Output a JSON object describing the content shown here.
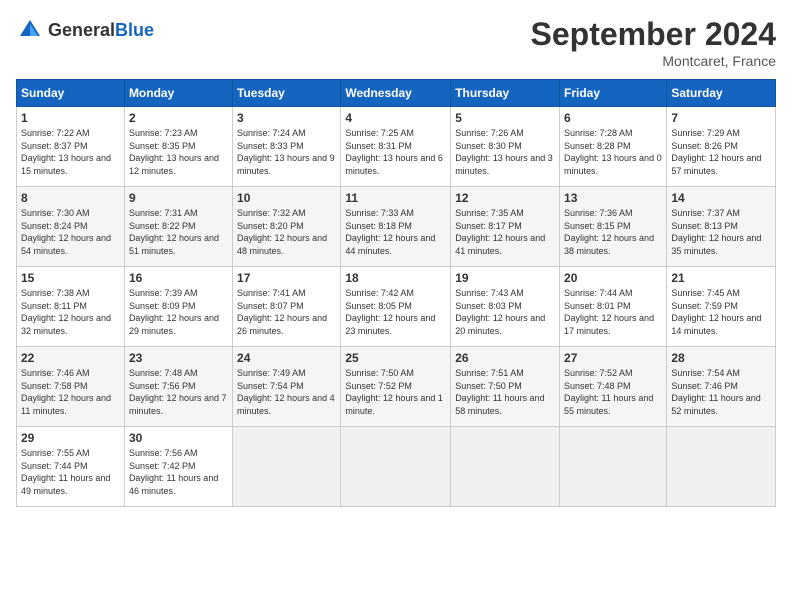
{
  "logo": {
    "general": "General",
    "blue": "Blue"
  },
  "header": {
    "title": "September 2024",
    "subtitle": "Montcaret, France"
  },
  "weekdays": [
    "Sunday",
    "Monday",
    "Tuesday",
    "Wednesday",
    "Thursday",
    "Friday",
    "Saturday"
  ],
  "weeks": [
    [
      {
        "day": "1",
        "info": "Sunrise: 7:22 AM\nSunset: 8:37 PM\nDaylight: 13 hours and 15 minutes."
      },
      {
        "day": "2",
        "info": "Sunrise: 7:23 AM\nSunset: 8:35 PM\nDaylight: 13 hours and 12 minutes."
      },
      {
        "day": "3",
        "info": "Sunrise: 7:24 AM\nSunset: 8:33 PM\nDaylight: 13 hours and 9 minutes."
      },
      {
        "day": "4",
        "info": "Sunrise: 7:25 AM\nSunset: 8:31 PM\nDaylight: 13 hours and 6 minutes."
      },
      {
        "day": "5",
        "info": "Sunrise: 7:26 AM\nSunset: 8:30 PM\nDaylight: 13 hours and 3 minutes."
      },
      {
        "day": "6",
        "info": "Sunrise: 7:28 AM\nSunset: 8:28 PM\nDaylight: 13 hours and 0 minutes."
      },
      {
        "day": "7",
        "info": "Sunrise: 7:29 AM\nSunset: 8:26 PM\nDaylight: 12 hours and 57 minutes."
      }
    ],
    [
      {
        "day": "8",
        "info": "Sunrise: 7:30 AM\nSunset: 8:24 PM\nDaylight: 12 hours and 54 minutes."
      },
      {
        "day": "9",
        "info": "Sunrise: 7:31 AM\nSunset: 8:22 PM\nDaylight: 12 hours and 51 minutes."
      },
      {
        "day": "10",
        "info": "Sunrise: 7:32 AM\nSunset: 8:20 PM\nDaylight: 12 hours and 48 minutes."
      },
      {
        "day": "11",
        "info": "Sunrise: 7:33 AM\nSunset: 8:18 PM\nDaylight: 12 hours and 44 minutes."
      },
      {
        "day": "12",
        "info": "Sunrise: 7:35 AM\nSunset: 8:17 PM\nDaylight: 12 hours and 41 minutes."
      },
      {
        "day": "13",
        "info": "Sunrise: 7:36 AM\nSunset: 8:15 PM\nDaylight: 12 hours and 38 minutes."
      },
      {
        "day": "14",
        "info": "Sunrise: 7:37 AM\nSunset: 8:13 PM\nDaylight: 12 hours and 35 minutes."
      }
    ],
    [
      {
        "day": "15",
        "info": "Sunrise: 7:38 AM\nSunset: 8:11 PM\nDaylight: 12 hours and 32 minutes."
      },
      {
        "day": "16",
        "info": "Sunrise: 7:39 AM\nSunset: 8:09 PM\nDaylight: 12 hours and 29 minutes."
      },
      {
        "day": "17",
        "info": "Sunrise: 7:41 AM\nSunset: 8:07 PM\nDaylight: 12 hours and 26 minutes."
      },
      {
        "day": "18",
        "info": "Sunrise: 7:42 AM\nSunset: 8:05 PM\nDaylight: 12 hours and 23 minutes."
      },
      {
        "day": "19",
        "info": "Sunrise: 7:43 AM\nSunset: 8:03 PM\nDaylight: 12 hours and 20 minutes."
      },
      {
        "day": "20",
        "info": "Sunrise: 7:44 AM\nSunset: 8:01 PM\nDaylight: 12 hours and 17 minutes."
      },
      {
        "day": "21",
        "info": "Sunrise: 7:45 AM\nSunset: 7:59 PM\nDaylight: 12 hours and 14 minutes."
      }
    ],
    [
      {
        "day": "22",
        "info": "Sunrise: 7:46 AM\nSunset: 7:58 PM\nDaylight: 12 hours and 11 minutes."
      },
      {
        "day": "23",
        "info": "Sunrise: 7:48 AM\nSunset: 7:56 PM\nDaylight: 12 hours and 7 minutes."
      },
      {
        "day": "24",
        "info": "Sunrise: 7:49 AM\nSunset: 7:54 PM\nDaylight: 12 hours and 4 minutes."
      },
      {
        "day": "25",
        "info": "Sunrise: 7:50 AM\nSunset: 7:52 PM\nDaylight: 12 hours and 1 minute."
      },
      {
        "day": "26",
        "info": "Sunrise: 7:51 AM\nSunset: 7:50 PM\nDaylight: 11 hours and 58 minutes."
      },
      {
        "day": "27",
        "info": "Sunrise: 7:52 AM\nSunset: 7:48 PM\nDaylight: 11 hours and 55 minutes."
      },
      {
        "day": "28",
        "info": "Sunrise: 7:54 AM\nSunset: 7:46 PM\nDaylight: 11 hours and 52 minutes."
      }
    ],
    [
      {
        "day": "29",
        "info": "Sunrise: 7:55 AM\nSunset: 7:44 PM\nDaylight: 11 hours and 49 minutes."
      },
      {
        "day": "30",
        "info": "Sunrise: 7:56 AM\nSunset: 7:42 PM\nDaylight: 11 hours and 46 minutes."
      },
      {
        "day": "",
        "info": ""
      },
      {
        "day": "",
        "info": ""
      },
      {
        "day": "",
        "info": ""
      },
      {
        "day": "",
        "info": ""
      },
      {
        "day": "",
        "info": ""
      }
    ]
  ]
}
